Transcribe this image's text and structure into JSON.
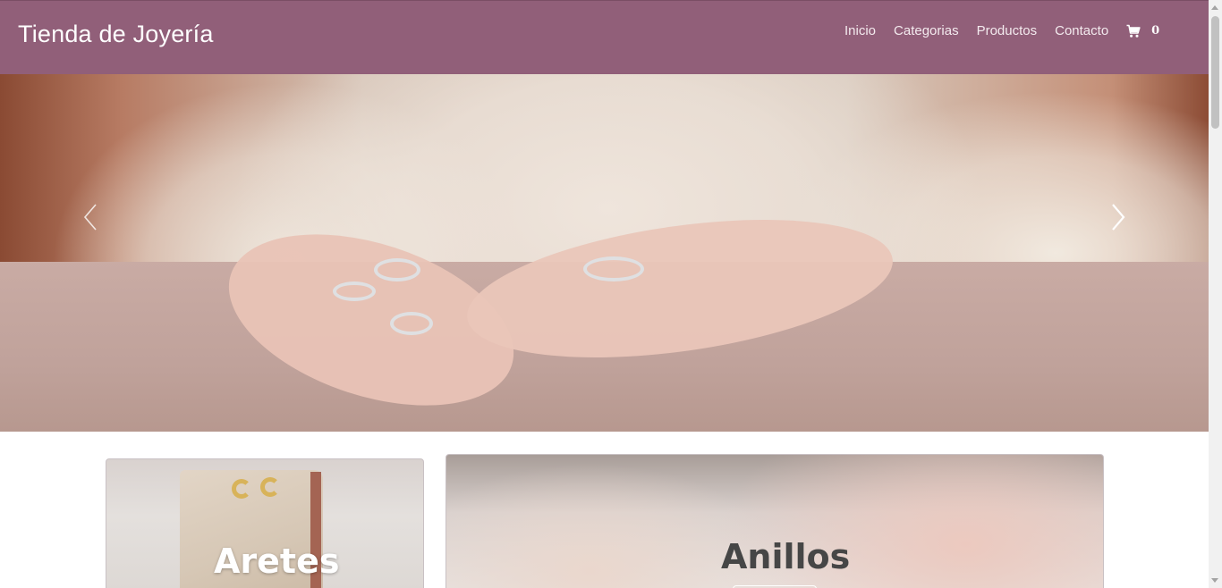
{
  "navbar": {
    "brand": "Tienda de Joyería",
    "links": [
      {
        "label": "Inicio"
      },
      {
        "label": "Categorias"
      },
      {
        "label": "Productos"
      },
      {
        "label": "Contacto"
      }
    ],
    "cart": {
      "icon": "cart-icon",
      "count": "0"
    }
  },
  "carousel": {
    "prev_icon": "chevron-left-icon",
    "next_icon": "chevron-right-icon"
  },
  "categories": [
    {
      "title": "Aretes"
    },
    {
      "title": "Anillos"
    }
  ],
  "colors": {
    "navbar_bg": "#915f79",
    "brand_text": "#ffffff",
    "nav_text": "#f3eaee"
  }
}
